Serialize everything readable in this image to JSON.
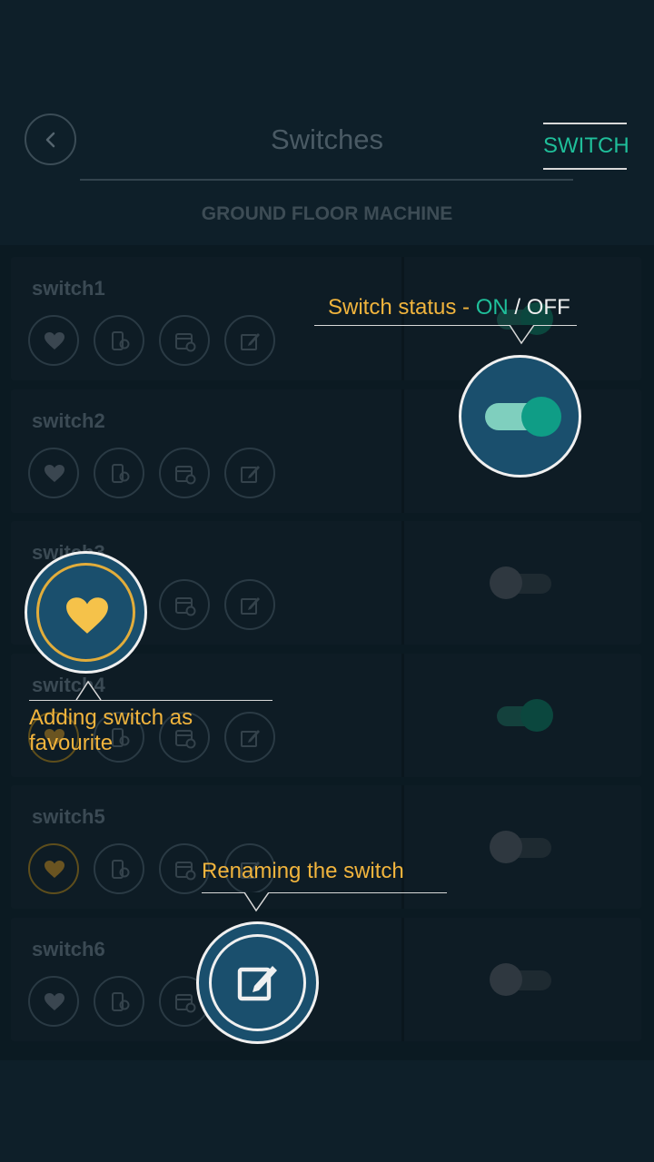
{
  "header": {
    "title": "Switches",
    "subtitle": "GROUND FLOOR MACHINE",
    "tab_label": "SWITCH"
  },
  "switches": [
    {
      "name": "switch1",
      "favourite": false,
      "state": "on"
    },
    {
      "name": "switch2",
      "favourite": false,
      "state": "on"
    },
    {
      "name": "switch3",
      "favourite": false,
      "state": "off"
    },
    {
      "name": "switch4",
      "favourite": true,
      "state": "on"
    },
    {
      "name": "switch5",
      "favourite": true,
      "state": "off"
    },
    {
      "name": "switch6",
      "favourite": false,
      "state": "off"
    }
  ],
  "callouts": {
    "status_prefix": "Switch status - ",
    "status_on": "ON",
    "status_sep": " / ",
    "status_off": "OFF",
    "favourite_line1": "Adding switch as",
    "favourite_line2": "favourite",
    "rename": "Renaming the switch"
  },
  "colors": {
    "accent_green": "#1fbf9a",
    "callout_yellow": "#f1b43d",
    "favourite_yellow": "#f5c24a",
    "bubble_blue": "#1a4f6d"
  },
  "icons": [
    "chevron-left-icon",
    "heart-icon",
    "device-settings-icon",
    "schedule-icon",
    "edit-icon"
  ]
}
